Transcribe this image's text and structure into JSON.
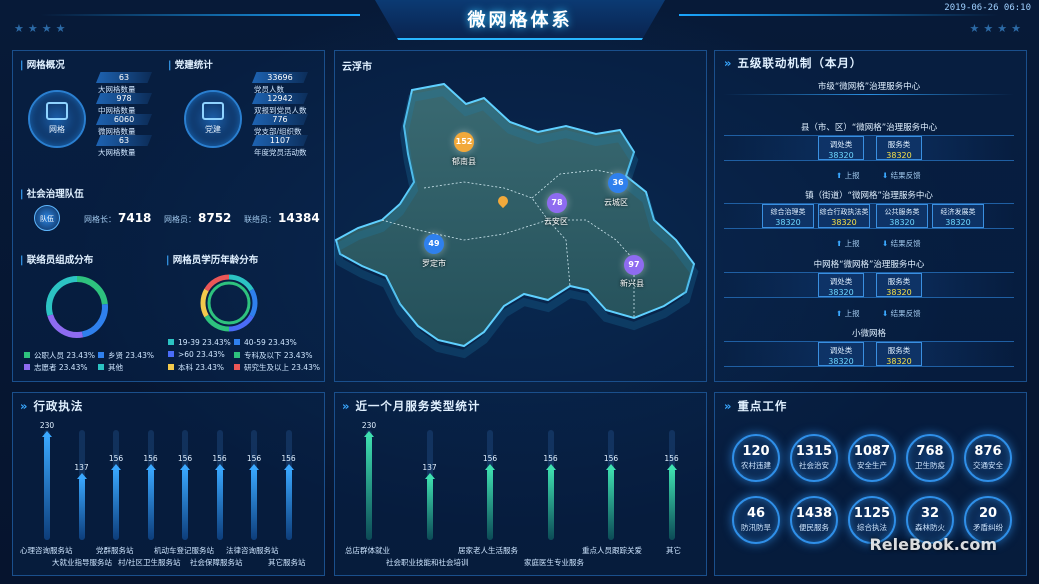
{
  "header": {
    "title": "微网格体系",
    "datetime": "2019-06-26  06:10",
    "stars": "★★★★",
    "stars_right": "★★★★"
  },
  "grid_overview": {
    "title": "网格概况",
    "icon_label": "网格",
    "stats": [
      {
        "value": "63",
        "label": "大网格数量"
      },
      {
        "value": "978",
        "label": "中网格数量"
      },
      {
        "value": "6060",
        "label": "微网格数量"
      },
      {
        "value": "63",
        "label": "大网格数量"
      }
    ]
  },
  "party_stats": {
    "title": "党建统计",
    "icon_label": "党建",
    "stats": [
      {
        "value": "33696",
        "label": "党员人数"
      },
      {
        "value": "12942",
        "label": "双报到党员人数"
      },
      {
        "value": "776",
        "label": "党支部/组织数"
      },
      {
        "value": "1107",
        "label": "年度党员活动数"
      }
    ]
  },
  "governance_team": {
    "title": "社会治理队伍",
    "icon_label": "队伍",
    "items": [
      {
        "label": "网格长：",
        "value": "7418"
      },
      {
        "label": "网格员：",
        "value": "8752"
      },
      {
        "label": "联络员：",
        "value": "14384"
      }
    ]
  },
  "liaison_composition": {
    "title": "联络员组成分布",
    "legend": [
      {
        "label": "公职人员  23.43%",
        "color": "#2ec27e"
      },
      {
        "label": "乡贤  23.43%",
        "color": "#2f80ed"
      },
      {
        "label": "志愿者  23.43%",
        "color": "#8e6bf0"
      },
      {
        "label": "其他",
        "color": "#2cc3c3"
      }
    ]
  },
  "grid_staff_distribution": {
    "title": "网格员学历年龄分布",
    "legend": [
      {
        "label": "19-39  23.43%",
        "color": "#2cc3c3"
      },
      {
        "label": "40-59  23.43%",
        "color": "#2f80ed"
      },
      {
        "label": ">60  23.43%",
        "color": "#4a6cf7"
      },
      {
        "label": "专科及以下  23.43%",
        "color": "#2ec27e"
      },
      {
        "label": "本科  23.43%",
        "color": "#f2c94c"
      },
      {
        "label": "研究生及以上  23.43%",
        "color": "#eb5757"
      }
    ]
  },
  "map": {
    "title": "云浮市",
    "regions": [
      {
        "name": "郁南县",
        "value": "152",
        "color": "#f2a93b"
      },
      {
        "name": "云安区",
        "value": "78",
        "color": "#8e6bf0"
      },
      {
        "name": "云城区",
        "value": "36",
        "color": "#2f80ed"
      },
      {
        "name": "罗定市",
        "value": "49",
        "color": "#2f80ed"
      },
      {
        "name": "新兴县",
        "value": "97",
        "color": "#8e6bf0"
      }
    ]
  },
  "mechanism": {
    "title": "五级联动机制（本月）",
    "level1": "市级“微网格”治理服务中心",
    "level2": "县（市、区）“微网格”治理服务中心",
    "level3": "镇（街道）“微网格”治理服务中心",
    "level4": "中网格“微网格”治理服务中心",
    "level5": "小微网格",
    "report": "上报",
    "feedback": "结果反馈",
    "box_pair": [
      {
        "label": "调处类",
        "value": "38320",
        "color": "#6fd8ff"
      },
      {
        "label": "服务类",
        "value": "38320",
        "color": "#f2e04c"
      }
    ],
    "box_four": [
      {
        "label": "综合治理类",
        "value": "38320",
        "color": "#6fd8ff"
      },
      {
        "label": "综合行政执法类",
        "value": "38320",
        "color": "#f2e04c"
      },
      {
        "label": "公共服务类",
        "value": "38320",
        "color": "#6fd8ff"
      },
      {
        "label": "经济发展类",
        "value": "38320",
        "color": "#6fd8ff"
      }
    ]
  },
  "admin_enforcement": {
    "title": "行政执法",
    "cat_row1": [
      "心理咨询服务站",
      "党群服务站",
      "机动车登记服务站",
      "法律咨询服务站"
    ],
    "cat_row2": [
      "大就业指导服务站",
      "村/社区卫生服务站",
      "社会保障服务站",
      "其它服务站"
    ]
  },
  "monthly_service": {
    "title": "近一个月服务类型统计",
    "cat_row1": [
      "总店群体就业",
      "居家老人生活服务",
      "重点人员跟踪关爱",
      "其它"
    ],
    "cat_row2": [
      "社会职业技能和社会培训",
      "家庭医生专业服务"
    ]
  },
  "key_work": {
    "title": "重点工作",
    "items": [
      {
        "value": "120",
        "label": "农村违建"
      },
      {
        "value": "1315",
        "label": "社会治安"
      },
      {
        "value": "1087",
        "label": "安全生产"
      },
      {
        "value": "768",
        "label": "卫生防疫"
      },
      {
        "value": "876",
        "label": "交通安全"
      },
      {
        "value": "46",
        "label": "防汛防旱"
      },
      {
        "value": "1438",
        "label": "便民服务"
      },
      {
        "value": "1125",
        "label": "综合执法"
      },
      {
        "value": "32",
        "label": "森林防火"
      },
      {
        "value": "20",
        "label": "矛盾纠纷"
      }
    ]
  },
  "watermark": "ReleBook.com",
  "chart_data": [
    {
      "type": "pie",
      "title": "联络员组成分布",
      "categories": [
        "公职人员",
        "乡贤",
        "志愿者",
        "其他"
      ],
      "values": [
        23.43,
        23.43,
        23.43,
        29.71
      ]
    },
    {
      "type": "pie",
      "title": "网格员学历年龄分布",
      "categories": [
        "19-39",
        "40-59",
        ">60",
        "专科及以下",
        "本科",
        "研究生及以上"
      ],
      "values": [
        23.43,
        23.43,
        23.43,
        23.43,
        23.43,
        23.43
      ]
    },
    {
      "type": "bar",
      "title": "行政执法",
      "categories": [
        "心理咨询服务站",
        "大就业指导服务站",
        "党群服务站",
        "村/社区卫生服务站",
        "机动车登记服务站",
        "社会保障服务站",
        "法律咨询服务站",
        "其它服务站"
      ],
      "values": [
        230,
        137,
        156,
        156,
        156,
        156,
        156,
        156
      ],
      "labels": [
        "230",
        "137",
        "156",
        "156",
        "156",
        "156",
        "156",
        "156"
      ],
      "ylim": [
        0,
        240
      ]
    },
    {
      "type": "bar",
      "title": "近一个月服务类型统计",
      "categories": [
        "总店群体就业",
        "社会职业技能和社会培训",
        "居家老人生活服务",
        "家庭医生专业服务",
        "重点人员跟踪关爱",
        "其它"
      ],
      "values": [
        230,
        137,
        156,
        156,
        156,
        156
      ],
      "labels": [
        "230",
        "137",
        "156",
        "156",
        "156",
        "156"
      ],
      "ylim": [
        0,
        240
      ]
    }
  ]
}
